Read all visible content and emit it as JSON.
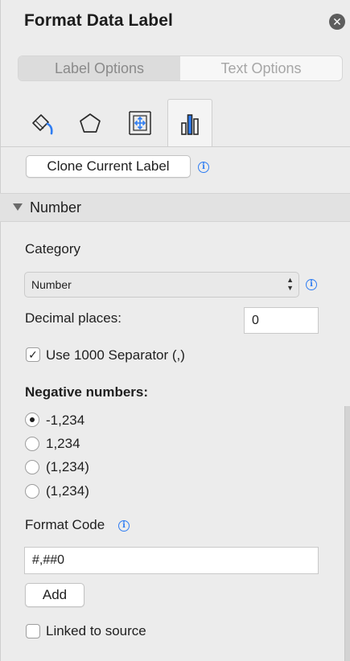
{
  "pane": {
    "title": "Format Data Label",
    "close_icon": "close-circle-icon"
  },
  "segmented": {
    "tabs": [
      {
        "label": "Label Options",
        "active": true
      },
      {
        "label": "Text Options",
        "active": false
      }
    ]
  },
  "icon_tabs": [
    {
      "name": "fill-line-icon",
      "selected": false
    },
    {
      "name": "effects-pentagon-icon",
      "selected": false
    },
    {
      "name": "size-properties-icon",
      "selected": false
    },
    {
      "name": "label-options-bar-chart-icon",
      "selected": true
    }
  ],
  "clone": {
    "button_label": "Clone Current Label",
    "info_icon": "i"
  },
  "number_section": {
    "title": "Number",
    "expanded": true,
    "category_label": "Category",
    "category_value": "Number",
    "category_info": "i",
    "decimal_label": "Decimal places:",
    "decimal_value": "0",
    "separator_label": "Use 1000 Separator (,)",
    "separator_checked": true,
    "negative_label": "Negative numbers:",
    "negative_options": [
      {
        "label": "-1,234",
        "selected": true
      },
      {
        "label": "1,234",
        "selected": false
      },
      {
        "label": "(1,234)",
        "selected": false
      },
      {
        "label": "(1,234)",
        "selected": false
      }
    ],
    "format_code_label": "Format Code",
    "format_code_info": "i",
    "format_code_value": "#,##0",
    "add_label": "Add",
    "linked_label": "Linked to source",
    "linked_checked": false
  },
  "colors": {
    "accent": "#2f7df2",
    "pane_bg": "#ececec",
    "icon_blue": "#2f7df2"
  }
}
